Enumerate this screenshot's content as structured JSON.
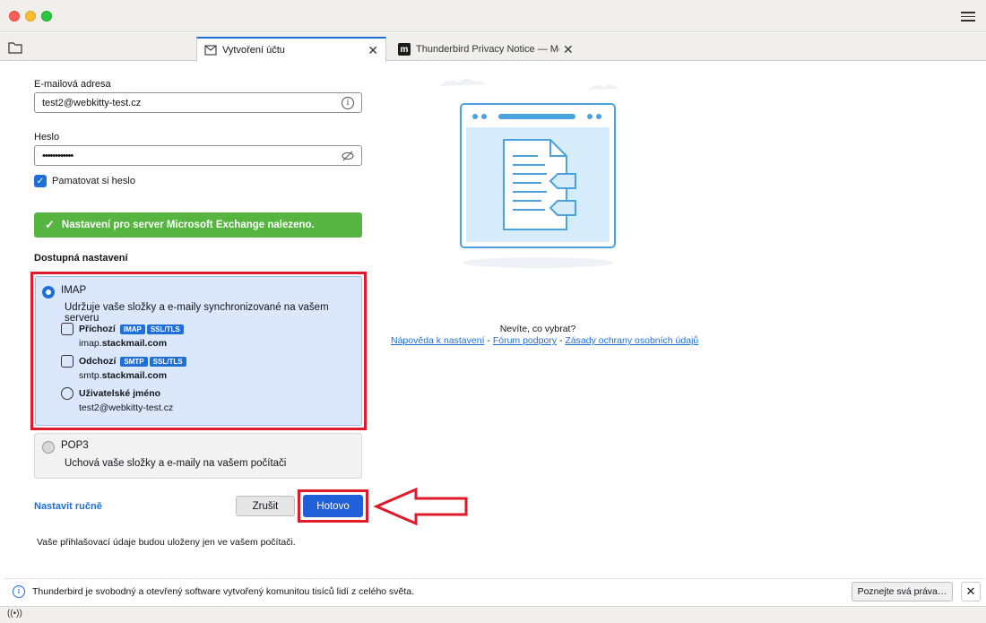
{
  "window": {
    "tabs": [
      {
        "label": "Vytvoření účtu",
        "icon": "envelope-icon"
      },
      {
        "label": "Thunderbird Privacy Notice — Mozilla",
        "icon": "mozilla-m-icon"
      }
    ]
  },
  "form": {
    "email_label": "E-mailová adresa",
    "email_value": "test2@webkitty-test.cz",
    "password_label": "Heslo",
    "password_value": "••••••••••••",
    "remember_label": "Pamatovat si heslo",
    "remember_checked": true
  },
  "success_message": "Nastavení pro server Microsoft Exchange nalezeno.",
  "available_title": "Dostupná nastavení",
  "imap": {
    "title": "IMAP",
    "desc": "Udržuje vaše složky a e-maily synchronizované na vašem serveru",
    "incoming_label": "Příchozí",
    "incoming_badges": [
      "IMAP",
      "SSL/TLS"
    ],
    "incoming_host_prefix": "imap.",
    "incoming_host_domain": "stackmail.com",
    "outgoing_label": "Odchozí",
    "outgoing_badges": [
      "SMTP",
      "SSL/TLS"
    ],
    "outgoing_host_prefix": "smtp.",
    "outgoing_host_domain": "stackmail.com",
    "username_label": "Uživatelské jméno",
    "username_value": "test2@webkitty-test.cz"
  },
  "pop3": {
    "title": "POP3",
    "desc": "Uchová vaše složky a e-maily na vašem počítači"
  },
  "actions": {
    "manual": "Nastavit ručně",
    "cancel": "Zrušit",
    "done": "Hotovo"
  },
  "note": "Vaše přihlašovací údaje budou uloženy jen ve vašem počítači.",
  "help": {
    "question": "Nevíte, co vybrat?",
    "link1": "Nápověda k nastavení",
    "sep": " - ",
    "link2": "Fórum podpory",
    "link3": "Zásady ochrany osobních údajů"
  },
  "notification": {
    "message": "Thunderbird je svobodný a otevřený software vytvořený komunitou tisíců lidí z celého světa.",
    "button": "Poznejte svá práva…"
  },
  "colors": {
    "accent": "#1f6fd8",
    "success": "#55b540",
    "highlight": "#e0192b"
  }
}
